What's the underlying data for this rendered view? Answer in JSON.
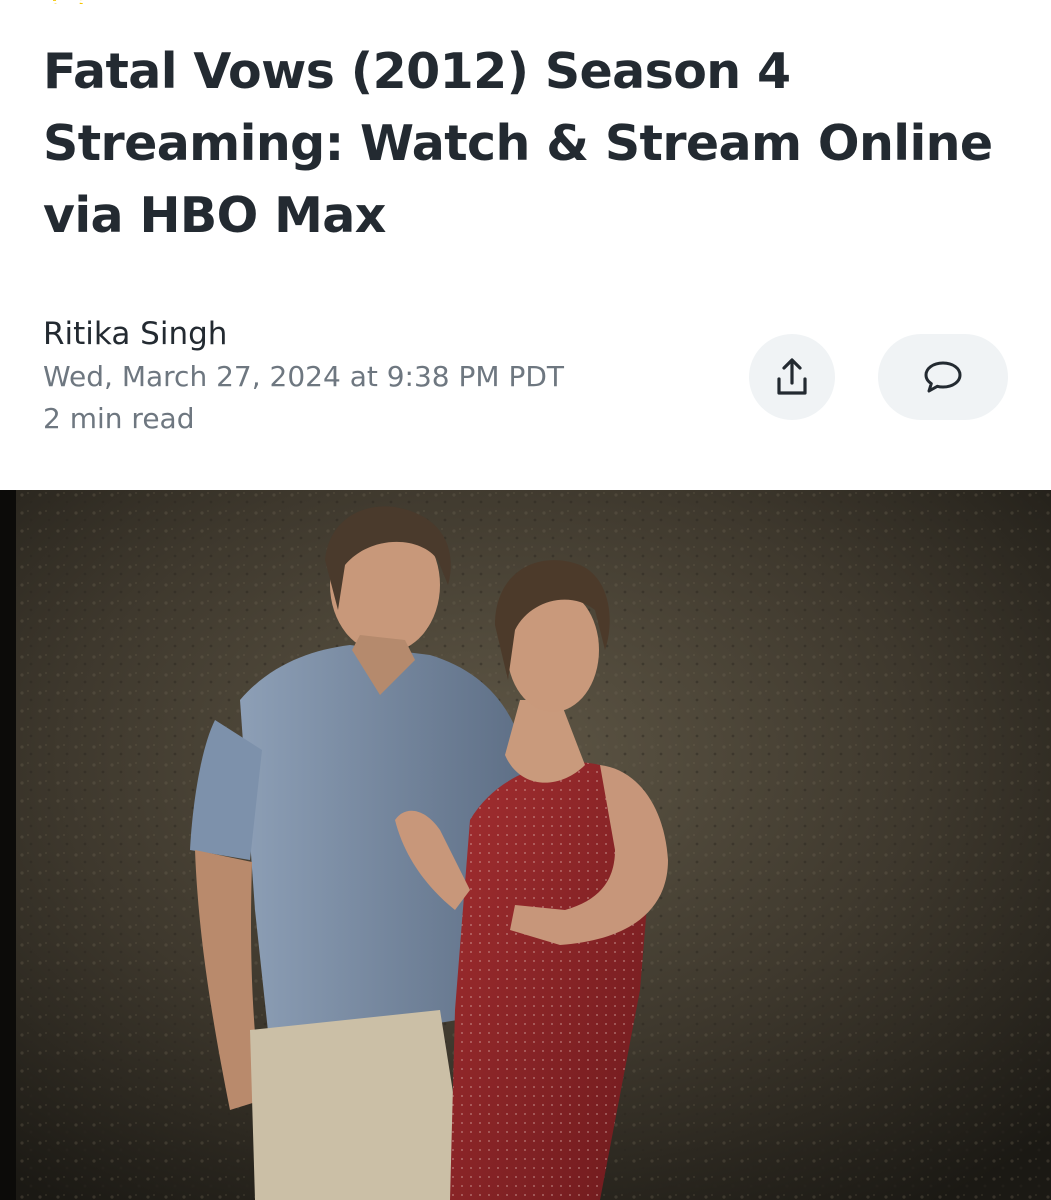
{
  "article": {
    "headline": "Fatal Vows (2012) Season 4 Streaming: Watch & Stream Online via HBO Max",
    "author": "Ritika Singh",
    "date": "Wed, March 27, 2024 at 9:38 PM PDT",
    "read_time": "2 min read"
  },
  "actions": {
    "share_icon": "share-icon",
    "comment_icon": "comment-icon"
  },
  "hero_image": {
    "subject": "man in blue shirt and woman in red dress posing against textured wall"
  },
  "colors": {
    "headline": "#232a31",
    "meta": "#6e7780",
    "button_bg": "#f0f3f5",
    "logo_accent": "#f5c400"
  }
}
